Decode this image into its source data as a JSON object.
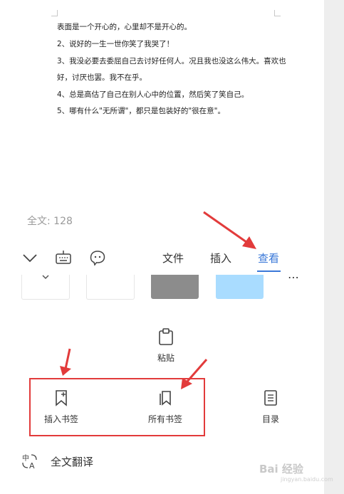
{
  "document": {
    "lines": [
      "表面是一个开心的，心里却不是开心的。",
      "2、说好的一生一世你笑了我哭了！",
      "3、我没必要去委屈自己去讨好任何人。况且我也没这么伟大。喜欢也",
      "好，讨厌也罢。我不在乎。",
      "4、总是高估了自己在别人心中的位置，然后笑了笑自己。",
      "5、哪有什么\"无所谓\"，都只是包装好的\"很在意\"。"
    ],
    "word_count": "全文: 128"
  },
  "toolbar": {
    "icons": [
      "chevron-down-icon",
      "keyboard-icon",
      "voice-assistant-icon"
    ],
    "tabs": {
      "file": "文件",
      "insert": "插入",
      "view": "查看"
    },
    "active_tab": "查看"
  },
  "tools": {
    "paste": "粘贴",
    "insert_bookmark": "插入书签",
    "all_bookmarks": "所有书签",
    "contents": "目录",
    "translate": "全文翻译"
  },
  "watermark": {
    "text": "Bai 经验",
    "sub": "jingyan.baidu.com"
  },
  "colors": {
    "accent": "#3a78d8",
    "annotation_red": "#e23b3b",
    "thumb_gray": "#8c8c8c",
    "thumb_blue": "#a9dcff"
  }
}
